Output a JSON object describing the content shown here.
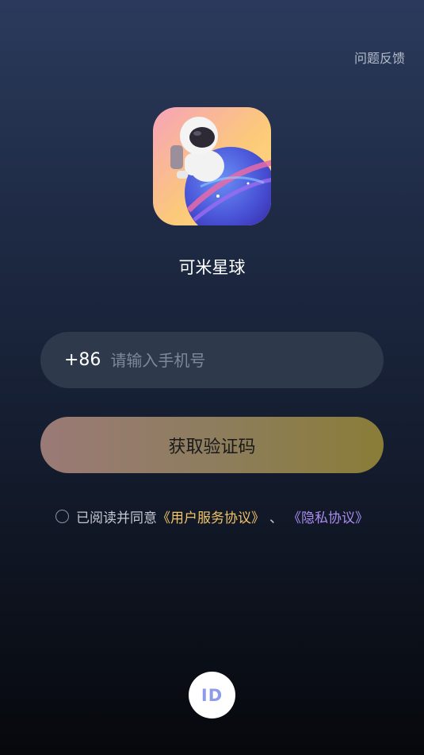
{
  "header": {
    "feedback_label": "问题反馈"
  },
  "app": {
    "name": "可米星球",
    "icon": "astronaut-planet-app-icon"
  },
  "login_form": {
    "country_code": "+86",
    "phone_value": "",
    "phone_placeholder": "请输入手机号",
    "submit_label": "获取验证码"
  },
  "agreement": {
    "checked": false,
    "prefix": "已阅读并同意",
    "terms_label": "《用户服务协议》",
    "separator": "、",
    "privacy_label": "《隐私协议》"
  },
  "alt_login": {
    "id_label": "ID"
  },
  "colors": {
    "terms": "#f2c467",
    "privacy": "#a98df0",
    "id_text": "#8e9bea"
  }
}
